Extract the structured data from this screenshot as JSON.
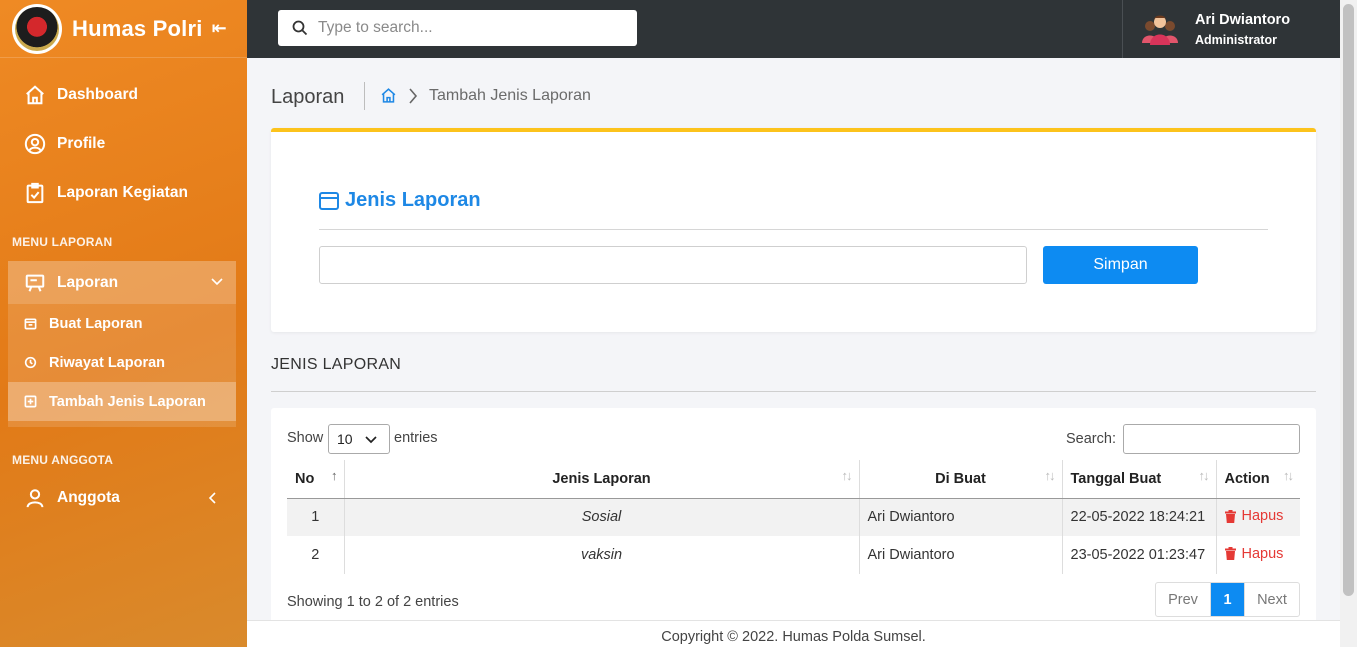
{
  "brand": {
    "title": "Humas Polri",
    "collapse_icon": "collapse-left-icon"
  },
  "sidebar": {
    "items": [
      {
        "label": "Dashboard",
        "icon": "home-icon"
      },
      {
        "label": "Profile",
        "icon": "user-circle-icon"
      },
      {
        "label": "Laporan Kegiatan",
        "icon": "clipboard-check-icon"
      }
    ],
    "section_laporan": "MENU LAPORAN",
    "laporan": {
      "label": "Laporan",
      "sub": [
        {
          "label": "Buat Laporan"
        },
        {
          "label": "Riwayat Laporan"
        },
        {
          "label": "Tambah Jenis Laporan",
          "active": true
        }
      ]
    },
    "section_anggota": "MENU ANGGOTA",
    "anggota": {
      "label": "Anggota"
    }
  },
  "topbar": {
    "search_placeholder": "Type to search...",
    "user_name": "Ari Dwiantoro",
    "user_role": "Administrator"
  },
  "header": {
    "title": "Laporan",
    "breadcrumb_current": "Tambah Jenis Laporan"
  },
  "form": {
    "title": "Jenis Laporan",
    "input_value": "",
    "save_label": "Simpan"
  },
  "list": {
    "heading": "JENIS LAPORAN",
    "show_label": "Show",
    "length_value": "10",
    "entries_label": "entries",
    "search_label": "Search:",
    "columns": [
      "No",
      "Jenis Laporan",
      "Di Buat",
      "Tanggal Buat",
      "Action"
    ],
    "rows": [
      {
        "no": "1",
        "jenis": "Sosial",
        "dibuat": "Ari Dwiantoro",
        "tanggal": "22-05-2022 18:24:21",
        "action": "Hapus"
      },
      {
        "no": "2",
        "jenis": "vaksin",
        "dibuat": "Ari Dwiantoro",
        "tanggal": "23-05-2022 01:23:47",
        "action": "Hapus"
      }
    ],
    "info": "Showing 1 to 2 of 2 entries",
    "pager": {
      "prev": "Prev",
      "current": "1",
      "next": "Next"
    }
  },
  "footer": {
    "copyright": "Copyright © 2022. Humas Polda Sumsel."
  },
  "colors": {
    "accent": "#0d8bf2",
    "sidebar": "#e27a17",
    "card_border": "#fcc31c",
    "danger": "#e53935"
  }
}
